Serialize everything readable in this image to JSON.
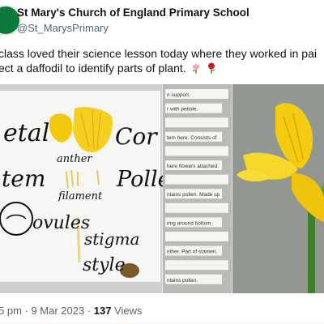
{
  "tweet": {
    "display_name": "St Mary's Church of England Primary School",
    "handle": "@St_MarysPrimary",
    "text_line1": "class loved their science lesson today where they worked in pai",
    "text_line2": "ect a daffodil to identify parts of plant.",
    "emoji_1": "tulip",
    "emoji_2": "rose"
  },
  "photo_left": {
    "labels": [
      "etal",
      "Cor",
      "tem",
      "Polle",
      "anther",
      "filament",
      "ovules",
      "stigma",
      "style"
    ]
  },
  "photo_middle": {
    "strips": [
      "n support.",
      "r with petiole.",
      "",
      "tem here. Consists of",
      "",
      "here flowers attached.",
      "",
      "ntains pollen. Made up",
      "",
      "ring around bottom.",
      "",
      "nther. Part of stamen.",
      "",
      "ntains pollen."
    ]
  },
  "meta": {
    "time": "5 pm · 9 Mar 2023 · ",
    "views_count": "137",
    "views_label": " Views"
  },
  "colors": {
    "brand_green": "#0b7a3b",
    "petal_yellow": "#f2c811",
    "text_primary": "#0f1419",
    "text_secondary": "#536471"
  }
}
